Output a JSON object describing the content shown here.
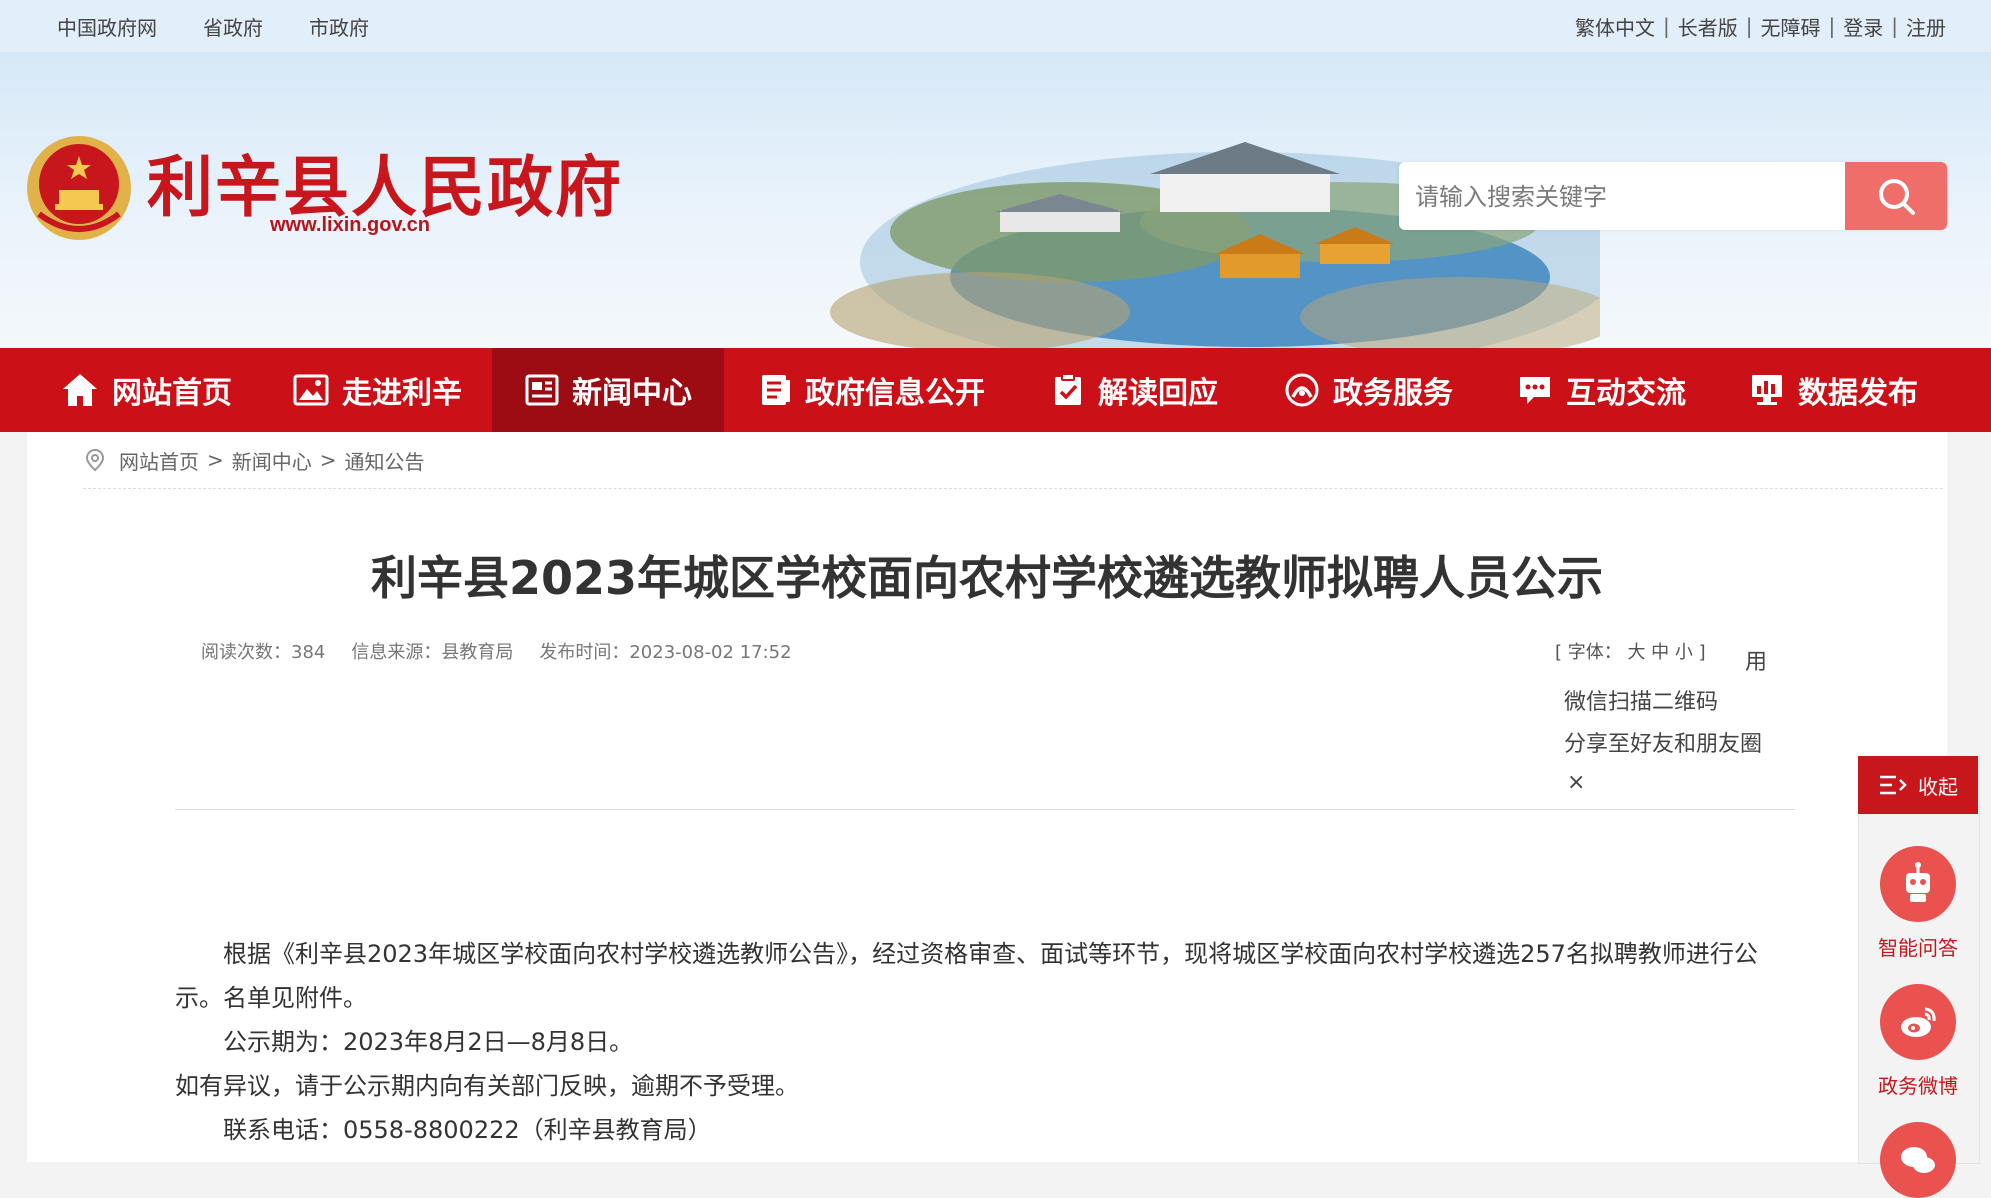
{
  "topbar": {
    "left_links": [
      "中国政府网",
      "省政府",
      "市政府"
    ],
    "right_links": [
      "繁体中文",
      "长者版",
      "无障碍",
      "登录",
      "注册"
    ],
    "separator": "|"
  },
  "header": {
    "site_title": "利辛县人民政府",
    "site_url": "www.lixin.gov.cn"
  },
  "search": {
    "placeholder": "请输入搜索关键字"
  },
  "nav": {
    "items": [
      {
        "label": "网站首页",
        "icon": "home-icon"
      },
      {
        "label": "走进利辛",
        "icon": "image-icon"
      },
      {
        "label": "新闻中心",
        "icon": "news-icon"
      },
      {
        "label": "政府信息公开",
        "icon": "document-icon"
      },
      {
        "label": "解读回应",
        "icon": "clipboard-check-icon"
      },
      {
        "label": "政务服务",
        "icon": "service-icon"
      },
      {
        "label": "互动交流",
        "icon": "chat-icon"
      },
      {
        "label": "数据发布",
        "icon": "chart-icon"
      }
    ],
    "active_index": 2
  },
  "breadcrumb": {
    "items": [
      "网站首页",
      "新闻中心",
      "通知公告"
    ],
    "separator": ">"
  },
  "article": {
    "title": "利辛县2023年城区学校面向农村学校遴选教师拟聘人员公示",
    "read_count": "阅读次数：384",
    "source": "信息来源：县教育局",
    "publish_time": "发布时间：2023-08-02 17:52",
    "font_size_label": "[ 字体： 大 中 小 ]",
    "paragraphs": [
      "根据《利辛县2023年城区学校面向农村学校遴选教师公告》，经过资格审查、面试等环节，现将城区学校面向农村学校遴选257名拟聘教师进行公示。名单见附件。",
      "公示期为：2023年8月2日—8月8日。",
      "如有异议，请于公示期内向有关部门反映，逾期不予受理。",
      "联系电话：0558-8800222（利辛县教育局）"
    ]
  },
  "share": {
    "use_label": "用",
    "line1": "微信扫描二维码",
    "line2": "分享至好友和朋友圈",
    "close": "×"
  },
  "float_panel": {
    "collapse_label": "收起",
    "items": [
      {
        "label": "智能问答",
        "icon": "robot-icon"
      },
      {
        "label": "政务微博",
        "icon": "weibo-icon"
      }
    ]
  },
  "colors": {
    "brand_red": "#cc1018",
    "nav_active": "#9d0c12",
    "search_button": "#ef6e69",
    "topbar_bg": "#e2eef9"
  }
}
